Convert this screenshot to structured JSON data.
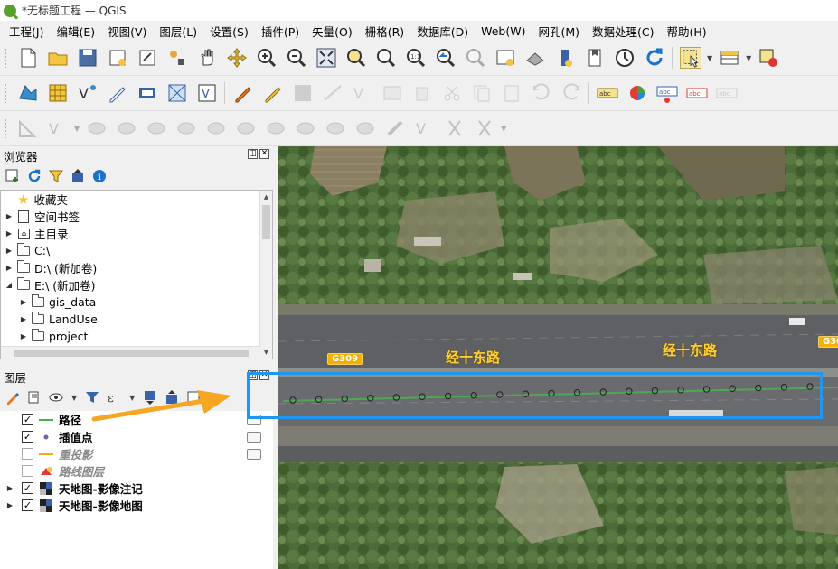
{
  "window": {
    "title": "*无标题工程 — QGIS"
  },
  "menu": [
    "工程(J)",
    "编辑(E)",
    "视图(V)",
    "图层(L)",
    "设置(S)",
    "插件(P)",
    "矢量(O)",
    "栅格(R)",
    "数据库(D)",
    "Web(W)",
    "网孔(M)",
    "数据处理(C)",
    "帮助(H)"
  ],
  "toolbar_icons": {
    "row1": [
      "new-project-icon",
      "open-project-icon",
      "save-project-icon",
      "new-print-layout-icon",
      "show-layout-manager-icon",
      "style-manager-icon",
      "pan-icon",
      "pan-to-selection-icon",
      "zoom-in-icon",
      "zoom-out-icon",
      "zoom-full-icon",
      "zoom-to-selection-icon",
      "zoom-to-layer-icon",
      "zoom-native-icon",
      "zoom-last-icon",
      "zoom-next-icon",
      "new-map-view-icon",
      "new-3d-map-icon",
      "temporal-controller-icon",
      "new-bookmark-icon",
      "show-bookmarks-icon",
      "refresh-icon",
      "select-features-icon",
      "open-attribute-table-icon",
      "deselect-icon"
    ],
    "row2": [
      "add-vector-layer-icon",
      "add-raster-layer-icon",
      "add-delimited-text-icon",
      "digitize-icon",
      "add-gps-layer-icon",
      "add-mesh-layer-icon",
      "add-virtual-layer-icon",
      "current-edits-icon",
      "toggle-editing-icon",
      "save-edits-icon",
      "digitize-segment-icon",
      "vertex-tool-icon",
      "modify-attributes-icon",
      "delete-selected-icon",
      "cut-features-icon",
      "copy-features-icon",
      "paste-features-icon",
      "undo-icon",
      "redo-icon",
      "label-toolbar-icon",
      "diagram-icon",
      "label-pin-icon",
      "label-highlight-icon",
      "label-move-icon"
    ],
    "row3": [
      "advanced-digitize-icon",
      "add-ring-icon",
      "add-part-icon",
      "fill-ring-icon",
      "delete-ring-icon",
      "delete-part-icon",
      "reshape-icon",
      "offset-curve-icon",
      "simplify-icon",
      "split-features-icon",
      "split-parts-icon",
      "merge-features-icon",
      "merge-attributes-icon",
      "rotate-point-symbols-icon",
      "offset-point-symbols-icon",
      "trim-extend-icon"
    ]
  },
  "browser": {
    "title": "浏览器",
    "items": [
      {
        "label": "收藏夹",
        "icon": "star-icon",
        "expandable": false
      },
      {
        "label": "空间书签",
        "icon": "bookmark-icon",
        "expandable": true
      },
      {
        "label": "主目录",
        "icon": "home-folder-icon",
        "expandable": true
      },
      {
        "label": "C:\\",
        "icon": "folder-icon",
        "expandable": true
      },
      {
        "label": "D:\\ (新加卷)",
        "icon": "folder-icon",
        "expandable": true
      },
      {
        "label": "E:\\ (新加卷)",
        "icon": "folder-open-icon",
        "expandable": true,
        "expanded": true
      },
      {
        "label": "gis_data",
        "icon": "folder-icon",
        "expandable": true,
        "indent": 1
      },
      {
        "label": "LandUse",
        "icon": "folder-icon",
        "expandable": true,
        "indent": 1
      },
      {
        "label": "project",
        "icon": "folder-icon",
        "expandable": true,
        "indent": 1
      }
    ]
  },
  "layers": {
    "title": "图层",
    "items": [
      {
        "name": "路径",
        "checked": true,
        "symbol": "line",
        "color": "#4caf50",
        "italic": false,
        "editing": true
      },
      {
        "name": "插值点",
        "checked": true,
        "symbol": "point",
        "color": "#7b5ea7",
        "italic": false,
        "editing": true
      },
      {
        "name": "重投影",
        "checked": false,
        "symbol": "line",
        "color": "#f5a623",
        "italic": true,
        "editing": true
      },
      {
        "name": "路线图层",
        "checked": false,
        "symbol": "route",
        "color": "#e53935",
        "italic": true,
        "editing": false
      },
      {
        "name": "天地图-影像注记",
        "checked": true,
        "symbol": "raster",
        "italic": false,
        "expandable": true
      },
      {
        "name": "天地图-影像地图",
        "checked": true,
        "symbol": "raster",
        "italic": false,
        "expandable": true
      }
    ]
  },
  "map": {
    "road_labels": [
      "经十东路",
      "经十东路"
    ],
    "shields": [
      "G309",
      "G30"
    ],
    "highlight_color": "#1f96ef",
    "arrow_color": "#f5a623",
    "point_count": 21
  }
}
